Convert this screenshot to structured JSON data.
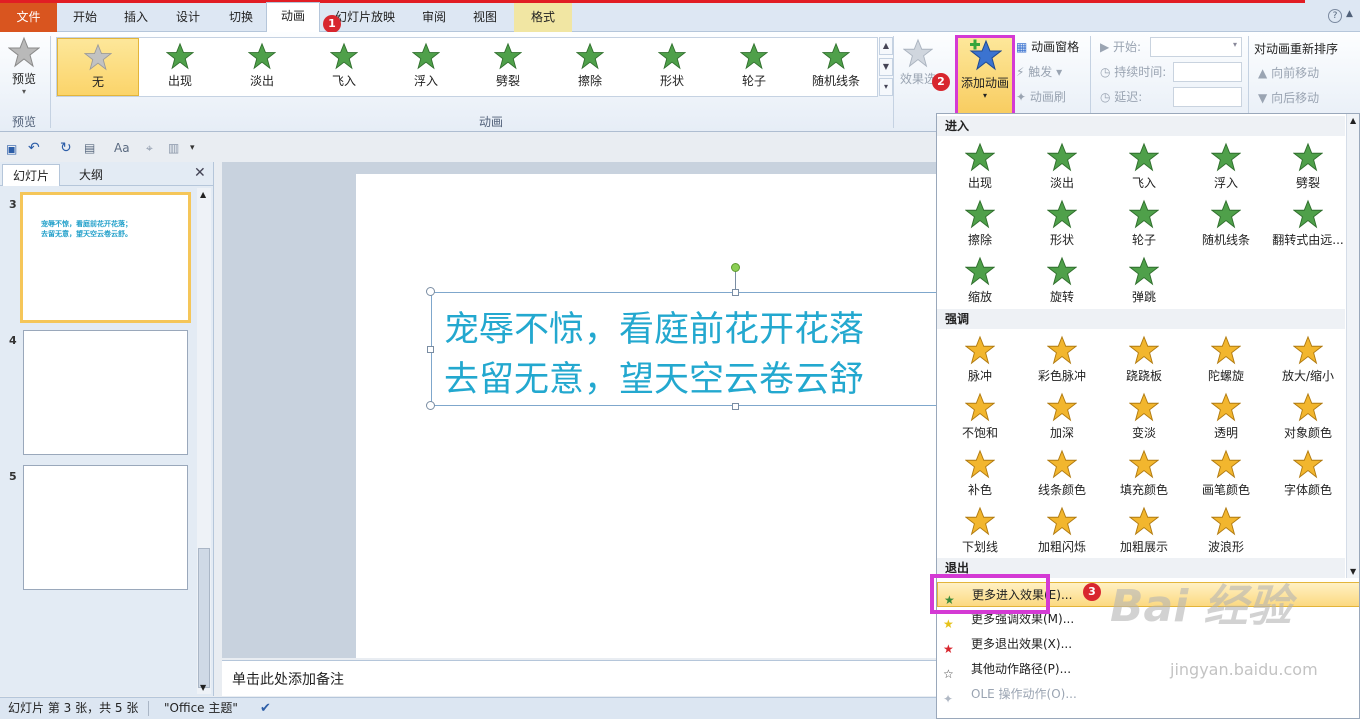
{
  "tabs": {
    "file": "文件",
    "items": [
      "开始",
      "插入",
      "设计",
      "切换",
      "动画",
      "幻灯片放映",
      "审阅",
      "视图",
      "格式"
    ],
    "active": "动画"
  },
  "ribbon": {
    "preview_label": "预览",
    "preview_group": "预览",
    "gallery": [
      "无",
      "出现",
      "淡出",
      "飞入",
      "浮入",
      "劈裂",
      "擦除",
      "形状",
      "轮子",
      "随机线条"
    ],
    "animation_group": "动画",
    "effect_options": "效果选",
    "add_animation": "添加动画",
    "animation_pane": "动画窗格",
    "trigger": "触发",
    "animation_painter": "动画刷",
    "start_label": "开始:",
    "duration_label": "持续时间:",
    "delay_label": "延迟:",
    "reorder_title": "对动画重新排序",
    "move_earlier": "向前移动",
    "move_later": "向后移动"
  },
  "badges": [
    "1",
    "2",
    "3"
  ],
  "left_pane": {
    "tab_slides": "幻灯片",
    "tab_outline": "大纲",
    "slides": [
      {
        "num": "3",
        "line1": "宠辱不惊，看庭前花开花落；",
        "line2": "去留无意，望天空云卷云舒。",
        "selected": true
      },
      {
        "num": "4"
      },
      {
        "num": "5"
      }
    ]
  },
  "slide": {
    "line1": "宠辱不惊，看庭前花开花落",
    "line2": "去留无意，望天空云卷云舒",
    "text_color": "#23a8cf"
  },
  "notes_placeholder": "单击此处添加备注",
  "status": {
    "slide_info": "幻灯片 第 3 张，共 5 张",
    "theme": "\"Office 主题\""
  },
  "dropdown": {
    "enter_header": "进入",
    "enter": [
      "出现",
      "淡出",
      "飞入",
      "浮入",
      "劈裂",
      "擦除",
      "形状",
      "轮子",
      "随机线条",
      "翻转式由远...",
      "缩放",
      "旋转",
      "弹跳"
    ],
    "emphasis_header": "强调",
    "emphasis": [
      "脉冲",
      "彩色脉冲",
      "跷跷板",
      "陀螺旋",
      "放大/缩小",
      "不饱和",
      "加深",
      "变淡",
      "透明",
      "对象颜色",
      "补色",
      "线条颜色",
      "填充颜色",
      "画笔颜色",
      "字体颜色",
      "下划线",
      "加粗闪烁",
      "加粗展示",
      "波浪形"
    ],
    "exit_header": "退出",
    "menu": [
      "更多进入效果(E)...",
      "更多强调效果(M)...",
      "更多退出效果(X)...",
      "其他动作路径(P)...",
      "OLE 操作动作(O)..."
    ]
  },
  "watermark": {
    "logo": "Bai 经验",
    "url": "jingyan.baidu.com"
  },
  "colors": {
    "accent_highlight": "#d43ad4",
    "badge": "#d8262e",
    "file_tab": "#d9551f",
    "green_star": "#4fa04a",
    "gold_star": "#f2b62e"
  }
}
